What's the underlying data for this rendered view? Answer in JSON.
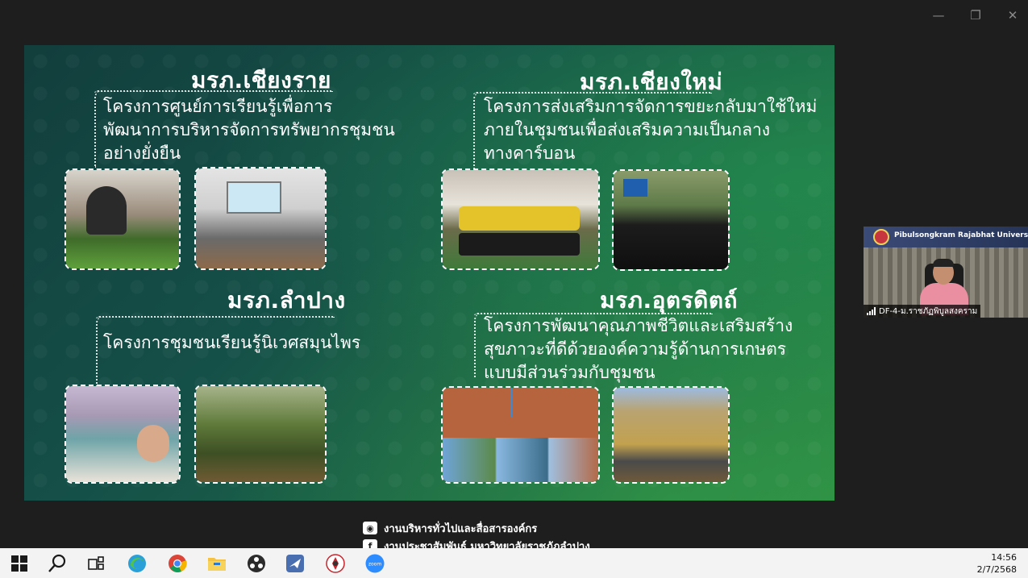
{
  "window": {
    "controls": [
      "minimize",
      "restore",
      "close"
    ]
  },
  "slide": {
    "sections": [
      {
        "university": "มรภ.เชียงราย",
        "project_lines": [
          "โครงการศูนย์การเรียนรู้เพื่อการ",
          "พัฒนาการบริหารจัดการทรัพยากรชุมชน",
          "อย่างยั่งยืน"
        ]
      },
      {
        "university": "มรภ.เชียงใหม่",
        "project_lines": [
          "โครงการส่งเสริมการจัดการขยะกลับมาใช้ใหม่",
          "ภายในชุมชนเพื่อส่งเสริมความเป็นกลาง",
          "ทางคาร์บอน"
        ]
      },
      {
        "university": "มรภ.ลำปาง",
        "project_lines": [
          "โครงการชุมชนเรียนรู้นิเวศสมุนไพร"
        ]
      },
      {
        "university": "มรภ.อุตรดิตถ์",
        "project_lines": [
          "โครงการพัฒนาคุณภาพชีวิตและเสริมสร้าง",
          "สุขภาวะที่ดีด้วยองค์ความรู้ด้านการเกษตร",
          "แบบมีส่วนร่วมกับชุมชน"
        ]
      }
    ]
  },
  "footer": {
    "line1": "งานบริหารทั่วไปและสื่อสารองค์กร",
    "line2": "งานประชาสัมพันธ์ มหาวิทยาลัยราชภัฏลำปาง"
  },
  "video": {
    "title": "Pibulsongkram Rajabhat University",
    "participant": "DF-4-ม.ราชภัฏพิบูลสงคราม"
  },
  "taskbar": {
    "apps": [
      "windows-start",
      "search",
      "task-view",
      "edge",
      "chrome",
      "file-explorer",
      "obs",
      "mail",
      "university-app",
      "zoom"
    ],
    "time": "14:56",
    "date": "2/7/2568"
  }
}
